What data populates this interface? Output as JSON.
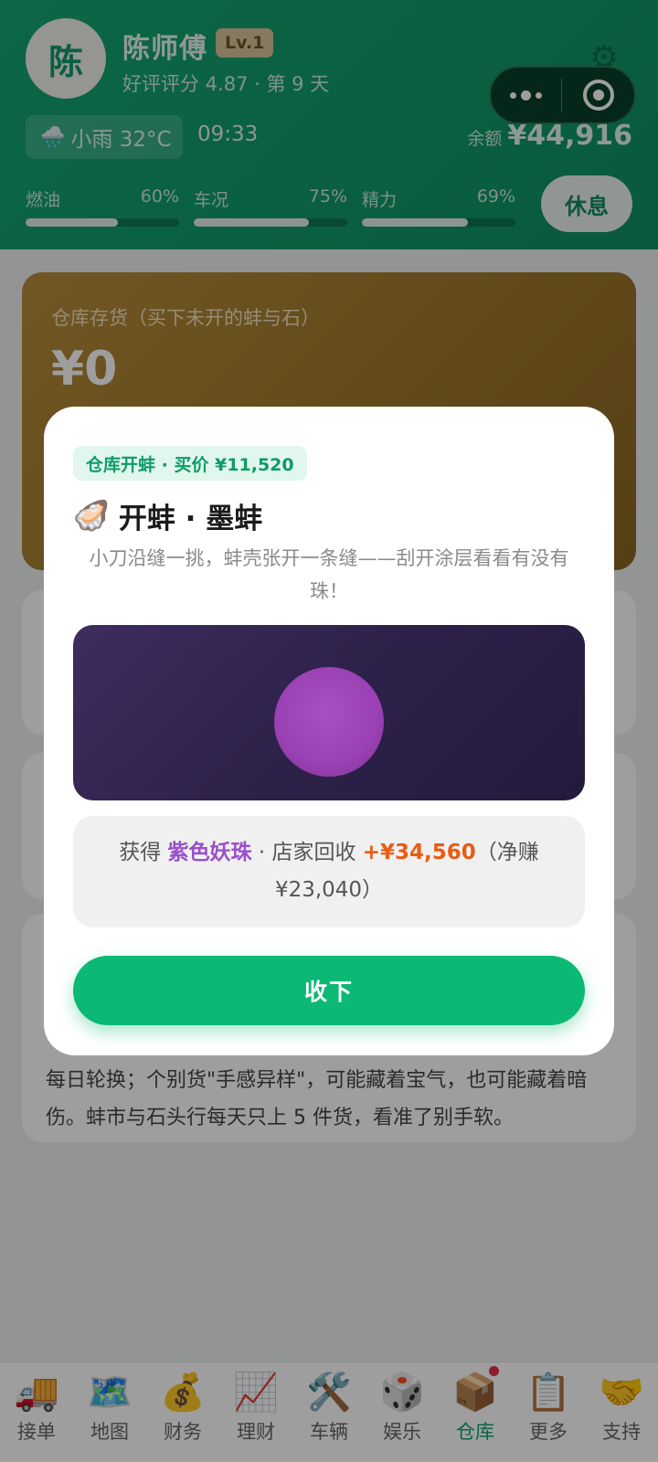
{
  "header": {
    "avatar_char": "陈",
    "name": "陈师傅",
    "level": "Lv.1",
    "rating_line": "好评评分 4.87 · 第 9 天",
    "weather": "小雨 32°C",
    "time": "09:33",
    "balance_label": "余额",
    "balance_value": "¥44,916",
    "stats": [
      {
        "label": "燃油",
        "value": "60%",
        "level": 0.6
      },
      {
        "label": "车况",
        "value": "75%",
        "level": 0.75
      },
      {
        "label": "精力",
        "value": "69%",
        "level": 0.69
      }
    ],
    "rest_button": "休息"
  },
  "warehouse": {
    "title": "仓库存货（买下未开的蚌与石）",
    "value": "¥0"
  },
  "tip": "每日轮换；个别货\"手感异样\"，可能藏着宝气，也可能藏着暗伤。蚌市与石头行每天只上 5 件货，看准了别手软。",
  "modal": {
    "tag": "仓库开蚌 · 买价 ¥11,520",
    "title": "开蚌 · 墨蚌",
    "description": "小刀沿缝一挑，蚌壳张开一条缝——刮开涂层看看有没有珠！",
    "result": {
      "prefix": "获得 ",
      "pearl_name": "紫色妖珠",
      "middle": " · 店家回收 ",
      "gain": "+¥34,560",
      "suffix": "（净赚 ¥23,040）"
    },
    "collect_button": "收下"
  },
  "tabs": [
    {
      "label": "接单",
      "icon": "🚚"
    },
    {
      "label": "地图",
      "icon": "🗺️"
    },
    {
      "label": "财务",
      "icon": "💰"
    },
    {
      "label": "理财",
      "icon": "📈"
    },
    {
      "label": "车辆",
      "icon": "🛠️"
    },
    {
      "label": "娱乐",
      "icon": "🎲"
    },
    {
      "label": "仓库",
      "icon": "📦"
    },
    {
      "label": "更多",
      "icon": "📋"
    },
    {
      "label": "支持",
      "icon": "🤝"
    }
  ],
  "colors": {
    "header_green": "#14a772",
    "accent_green": "#0bb874",
    "pearl_purple": "#9a41b4",
    "gain_orange": "#ea5b14"
  }
}
